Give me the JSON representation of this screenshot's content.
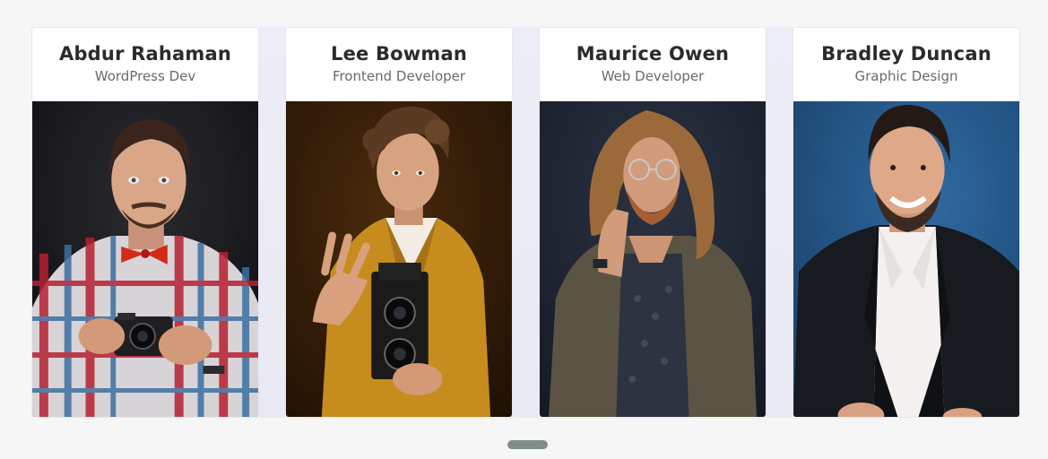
{
  "team": {
    "members": [
      {
        "name": "Abdur Rahaman",
        "role": "WordPress Dev",
        "photo_icon": "portrait-photo-camera-bowtie",
        "colors": {
          "bg": "#111114",
          "shirt_a": "#b71f30",
          "shirt_b": "#3b6fa0",
          "shirt_c": "#e9e6e4",
          "skin": "#d9a687",
          "hair": "#3a241b"
        }
      },
      {
        "name": "Lee Bowman",
        "role": "Frontend Developer",
        "photo_icon": "portrait-photo-vintage-camera",
        "colors": {
          "bg": "#2a1605",
          "jacket": "#c68c1e",
          "shirt": "#f2ece4",
          "skin": "#d7a27f",
          "hair": "#5a3a22",
          "camera": "#1a1a1a"
        }
      },
      {
        "name": "Maurice Owen",
        "role": "Web Developer",
        "photo_icon": "portrait-photo-long-hair",
        "colors": {
          "bg": "#1b2230",
          "cardigan": "#5b5444",
          "shirt": "#2d3340",
          "skin": "#d29c7c",
          "hair": "#9c6a3a"
        }
      },
      {
        "name": "Bradley Duncan",
        "role": "Graphic Design",
        "photo_icon": "portrait-photo-suit",
        "colors": {
          "bg": "#245d93",
          "suit": "#171a1f",
          "shirt": "#f3f0ef",
          "skin": "#dfa888",
          "hair": "#241915"
        }
      }
    ]
  },
  "pager": {
    "active_index": 0,
    "color": "#7f8e89"
  }
}
